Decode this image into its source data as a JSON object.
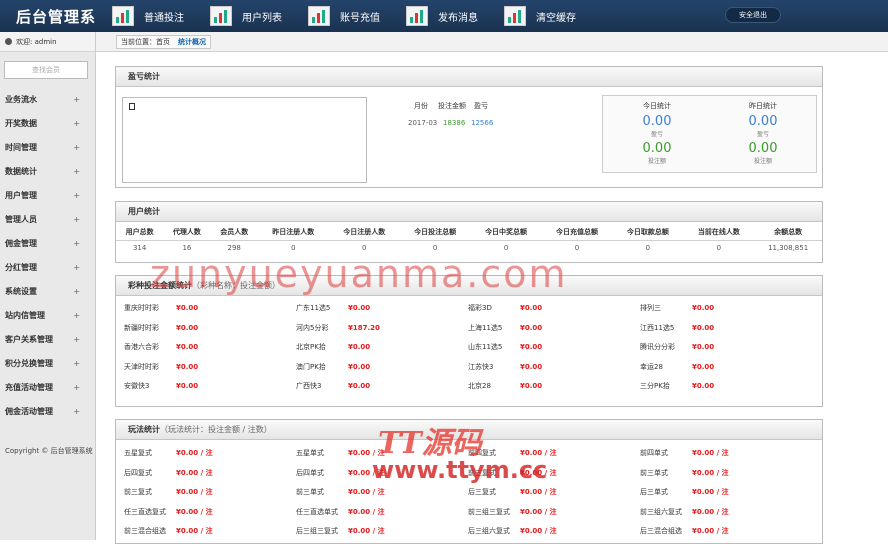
{
  "app": {
    "title": "后台管理系"
  },
  "nav": [
    {
      "label": "普通投注"
    },
    {
      "label": "用户列表"
    },
    {
      "label": "账号充值"
    },
    {
      "label": "发布消息"
    },
    {
      "label": "清空缓存"
    }
  ],
  "logout": "安全退出",
  "sidebar": {
    "welcome": "欢迎: admin",
    "search_placeholder": "查找会员",
    "items": [
      "业务流水",
      "开奖数据",
      "时间管理",
      "数据统计",
      "用户管理",
      "管理人员",
      "佣金管理",
      "分红管理",
      "系统设置",
      "站内信管理",
      "客户关系管理",
      "积分兑换管理",
      "充值活动管理",
      "佣金活动管理"
    ],
    "copyright": "Copyright © 后台管理系统"
  },
  "breadcrumb": {
    "prefix": "当前位置：首页",
    "current": "统计概况"
  },
  "profit": {
    "title": "盈亏统计",
    "mini_headers": [
      "月份",
      "投注金额",
      "盈亏"
    ],
    "mini_row": [
      "2017-03",
      "18386",
      "12566"
    ],
    "today": {
      "title": "今日统计",
      "a_val": "0.00",
      "a_lbl": "盈亏",
      "b_val": "0.00",
      "b_lbl": "投注额"
    },
    "yesterday": {
      "title": "昨日统计",
      "a_val": "0.00",
      "a_lbl": "盈亏",
      "b_val": "0.00",
      "b_lbl": "投注额"
    }
  },
  "users": {
    "title": "用户统计",
    "headers": [
      "用户总数",
      "代理人数",
      "会员人数",
      "昨日注册人数",
      "今日注册人数",
      "今日投注总额",
      "今日中奖总额",
      "今日充值总额",
      "今日取款总额",
      "当前在线人数",
      "余额总数"
    ],
    "values": [
      "314",
      "16",
      "298",
      "0",
      "0",
      "0",
      "0",
      "0",
      "0",
      "0",
      "11,308,851"
    ]
  },
  "lottery": {
    "title": "彩种投注金额统计",
    "sub": "（彩种名称：投注金额）",
    "rows": [
      [
        [
          "重庆时时彩",
          "¥0.00"
        ],
        [
          "广东11选5",
          "¥0.00"
        ],
        [
          "福彩3D",
          "¥0.00"
        ],
        [
          "排列三",
          "¥0.00"
        ]
      ],
      [
        [
          "新疆时时彩",
          "¥0.00"
        ],
        [
          "河内5分彩",
          "¥187.20"
        ],
        [
          "上海11选5",
          "¥0.00"
        ],
        [
          "江西11选5",
          "¥0.00"
        ]
      ],
      [
        [
          "香港六合彩",
          "¥0.00"
        ],
        [
          "北京PK拾",
          "¥0.00"
        ],
        [
          "山东11选5",
          "¥0.00"
        ],
        [
          "腾讯分分彩",
          "¥0.00"
        ]
      ],
      [
        [
          "天津时时彩",
          "¥0.00"
        ],
        [
          "澳门PK拾",
          "¥0.00"
        ],
        [
          "江苏快3",
          "¥0.00"
        ],
        [
          "幸运28",
          "¥0.00"
        ]
      ],
      [
        [
          "安徽快3",
          "¥0.00"
        ],
        [
          "广西快3",
          "¥0.00"
        ],
        [
          "北京28",
          "¥0.00"
        ],
        [
          "三分PK拾",
          "¥0.00"
        ]
      ]
    ]
  },
  "play": {
    "title": "玩法统计",
    "sub": "（玩法统计：投注金额 / 注数）",
    "rows": [
      [
        [
          "五星复式",
          "¥0.00 / 注"
        ],
        [
          "五星单式",
          "¥0.00 / 注"
        ],
        [
          "前四复式",
          "¥0.00 / 注"
        ],
        [
          "前四单式",
          "¥0.00 / 注"
        ]
      ],
      [
        [
          "后四复式",
          "¥0.00 / 注"
        ],
        [
          "后四单式",
          "¥0.00 / 注"
        ],
        [
          "前三复式",
          "¥0.00 / 注"
        ],
        [
          "前三单式",
          "¥0.00 / 注"
        ]
      ],
      [
        [
          "前三复式",
          "¥0.00 / 注"
        ],
        [
          "前三单式",
          "¥0.00 / 注"
        ],
        [
          "后三复式",
          "¥0.00 / 注"
        ],
        [
          "后三单式",
          "¥0.00 / 注"
        ]
      ],
      [
        [
          "任三直选复式",
          "¥0.00 / 注"
        ],
        [
          "任三直选单式",
          "¥0.00 / 注"
        ],
        [
          "前三组三复式",
          "¥0.00 / 注"
        ],
        [
          "前三组六复式",
          "¥0.00 / 注"
        ]
      ],
      [
        [
          "前三混合组选",
          "¥0.00 / 注"
        ],
        [
          "后三组三复式",
          "¥0.00 / 注"
        ],
        [
          "后三组六复式",
          "¥0.00 / 注"
        ],
        [
          "后三混合组选",
          "¥0.00 / 注"
        ]
      ]
    ]
  },
  "watermark": {
    "line1": "zunyueyuanma.com",
    "line2": "TT源码",
    "line3": "www.ttym.cc"
  }
}
